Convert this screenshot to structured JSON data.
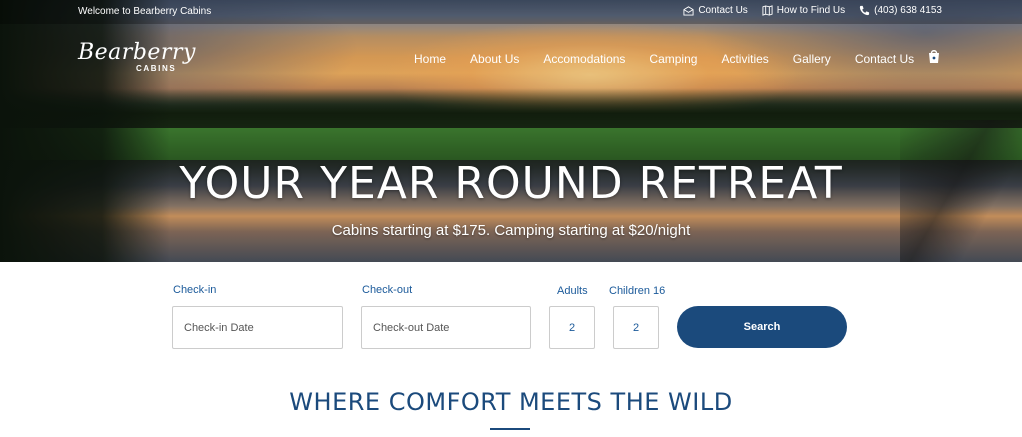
{
  "topbar": {
    "welcome": "Welcome to Bearberry Cabins",
    "contact_label": "Contact Us",
    "find_label": "How to Find Us",
    "phone": "(403) 638 4153"
  },
  "brand": {
    "name": "Bearberry",
    "sub": "CABINS"
  },
  "nav": {
    "items": [
      {
        "label": "Home"
      },
      {
        "label": "About Us"
      },
      {
        "label": "Accomodations"
      },
      {
        "label": "Camping"
      },
      {
        "label": "Activities"
      },
      {
        "label": "Gallery"
      },
      {
        "label": "Contact Us"
      }
    ]
  },
  "hero": {
    "title": "YOUR YEAR ROUND RETREAT",
    "subtitle": "Cabins starting at $175. Camping starting at $20/night"
  },
  "booking": {
    "checkin_label": "Check-in",
    "checkin_placeholder": "Check-in Date",
    "checkout_label": "Check-out",
    "checkout_placeholder": "Check-out Date",
    "adults_label": "Adults",
    "adults_value": "2",
    "children_label": "Children 16",
    "children_value": "2",
    "search_label": "Search"
  },
  "section": {
    "title": "WHERE COMFORT MEETS THE WILD"
  },
  "colors": {
    "primary": "#1b4a7c",
    "label_blue": "#1b5a9a"
  }
}
